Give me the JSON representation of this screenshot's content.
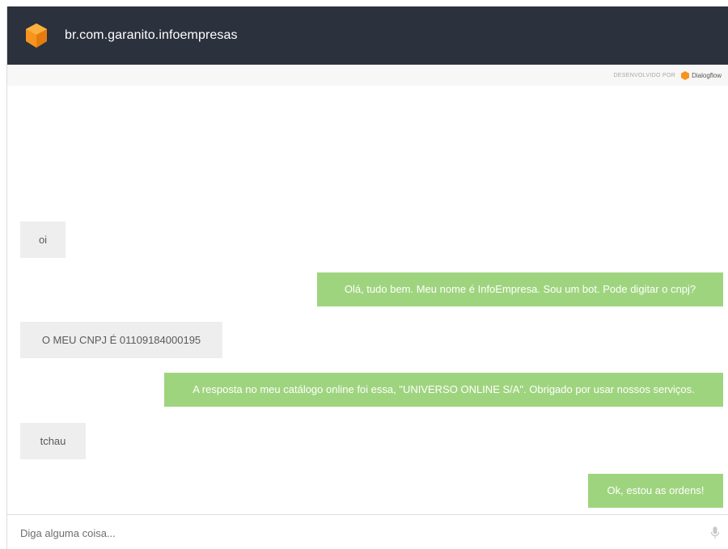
{
  "header": {
    "title": "br.com.garanito.infoempresas"
  },
  "powered_by": {
    "label": "DESENVOLVIDO POR",
    "brand": "Dialogflow"
  },
  "messages": [
    {
      "from": "user",
      "text": "oi"
    },
    {
      "from": "bot",
      "text": "Olá, tudo bem. Meu nome é InfoEmpresa. Sou um bot. Pode digitar o cnpj?"
    },
    {
      "from": "user",
      "text": "O MEU CNPJ É 01109184000195"
    },
    {
      "from": "bot",
      "text": "A resposta no meu catálogo online foi essa, \"UNIVERSO ONLINE S/A\". Obrigado por usar nossos serviços."
    },
    {
      "from": "user",
      "text": "tchau"
    },
    {
      "from": "bot",
      "text": "Ok, estou as ordens!"
    }
  ],
  "input": {
    "placeholder": "Diga alguma coisa...",
    "value": ""
  },
  "colors": {
    "header_bg": "#2b313d",
    "accent_orange": "#f7941d",
    "bot_bubble": "#9fd47f",
    "user_bubble": "#eeeeee"
  },
  "icons": {
    "logo": "cube-icon",
    "brand": "dialogflow-icon",
    "mic": "microphone-icon"
  }
}
